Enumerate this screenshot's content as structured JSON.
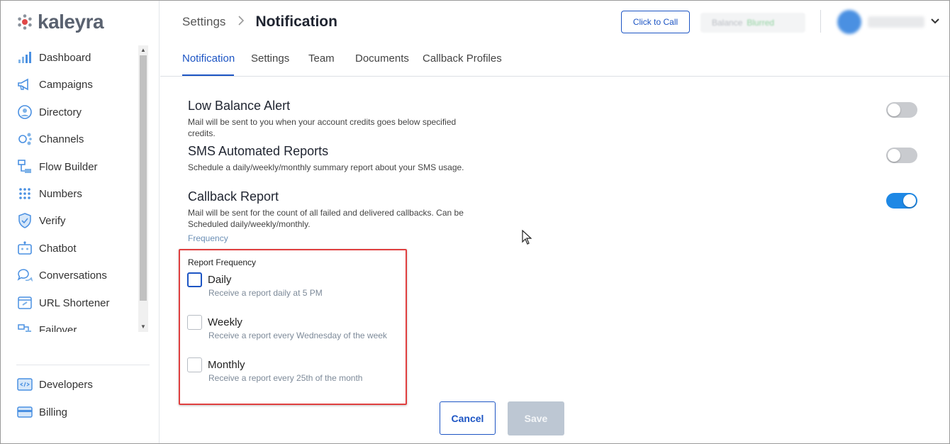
{
  "app": {
    "logo_text": "kaleyra"
  },
  "sidebar": {
    "items": [
      {
        "label": "Dashboard",
        "icon": "bar-chart-icon"
      },
      {
        "label": "Campaigns",
        "icon": "megaphone-icon"
      },
      {
        "label": "Directory",
        "icon": "contact-icon"
      },
      {
        "label": "Channels",
        "icon": "channels-icon"
      },
      {
        "label": "Flow Builder",
        "icon": "flow-icon"
      },
      {
        "label": "Numbers",
        "icon": "keypad-icon"
      },
      {
        "label": "Verify",
        "icon": "shield-icon"
      },
      {
        "label": "Chatbot",
        "icon": "bot-icon"
      },
      {
        "label": "Conversations",
        "icon": "chat-bubbles-icon"
      },
      {
        "label": "URL Shortener",
        "icon": "link-icon"
      },
      {
        "label": "Failover",
        "icon": "failover-icon"
      }
    ],
    "bottom_items": [
      {
        "label": "Developers",
        "icon": "code-icon"
      },
      {
        "label": "Billing",
        "icon": "credit-card-icon"
      }
    ]
  },
  "header": {
    "breadcrumb_parent": "Settings",
    "breadcrumb_current": "Notification",
    "click_to_call": "Click to Call",
    "balance_label": "Balance",
    "balance_value": "Blurred"
  },
  "tabs": [
    {
      "label": "Notification",
      "active": true
    },
    {
      "label": "Settings",
      "active": false
    },
    {
      "label": "Team",
      "active": false
    },
    {
      "label": "Documents",
      "active": false
    },
    {
      "label": "Callback Profiles",
      "active": false
    }
  ],
  "settings": [
    {
      "title": "Low Balance Alert",
      "desc": "Mail will be sent to you when your account credits goes below specified credits.",
      "enabled": false
    },
    {
      "title": "SMS Automated Reports",
      "desc": "Schedule a daily/weekly/monthly summary report about your SMS usage.",
      "enabled": false
    },
    {
      "title": "Callback Report",
      "desc": "Mail will be sent for the count of all failed and delivered callbacks. Can be Scheduled daily/weekly/monthly.",
      "enabled": true
    }
  ],
  "frequency_label": "Frequency",
  "report_frequency": {
    "title": "Report Frequency",
    "options": [
      {
        "name": "Daily",
        "sub": "Receive a report daily at 5 PM",
        "checked": false
      },
      {
        "name": "Weekly",
        "sub": "Receive a report every Wednesday of the week",
        "checked": false
      },
      {
        "name": "Monthly",
        "sub": "Receive a report every 25th of the month",
        "checked": false
      }
    ]
  },
  "actions": {
    "cancel": "Cancel",
    "save": "Save"
  },
  "colors": {
    "accent": "#1d55c4",
    "toggle_on": "#1e88e5",
    "highlight": "#e03f3f"
  }
}
